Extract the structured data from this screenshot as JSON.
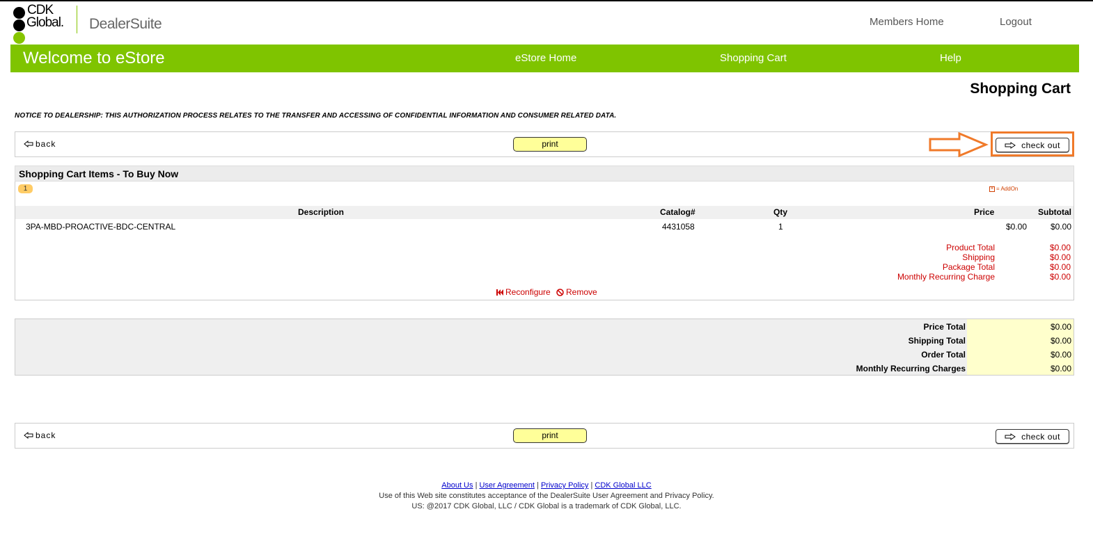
{
  "brand": {
    "cdk": "CDK",
    "global": "Global.",
    "product": "DealerSuite"
  },
  "top_nav": {
    "members_home": "Members Home",
    "logout": "Logout"
  },
  "store_bar": {
    "title": "Welcome to eStore",
    "estore_home": "eStore Home",
    "shopping_cart": "Shopping Cart",
    "help": "Help",
    "color": "#7fc400"
  },
  "page_title": "Shopping Cart",
  "notice": "NOTICE TO DEALERSHIP: THIS AUTHORIZATION PROCESS RELATES TO THE TRANSFER AND ACCESSING OF CONFIDENTIAL INFORMATION AND CONSUMER RELATED DATA.",
  "actions": {
    "back": "back",
    "print": "print",
    "checkout": "check out"
  },
  "cart": {
    "section_title": "Shopping Cart Items - To Buy Now",
    "badge": "1",
    "addon_legend": "= AddOn",
    "columns": {
      "description": "Description",
      "catalog": "Catalog#",
      "qty": "Qty",
      "price": "Price",
      "subtotal": "Subtotal"
    },
    "items": [
      {
        "description": "3PA-MBD-PROACTIVE-BDC-CENTRAL",
        "catalog": "4431058",
        "qty": "1",
        "price": "$0.00",
        "subtotal": "$0.00"
      }
    ],
    "totals": [
      {
        "label": "Product Total",
        "value": "$0.00"
      },
      {
        "label": "Shipping",
        "value": "$0.00"
      },
      {
        "label": "Package Total",
        "value": "$0.00"
      },
      {
        "label": "Monthly Recurring Charge",
        "value": "$0.00"
      }
    ],
    "reconfigure": "Reconfigure",
    "remove": "Remove"
  },
  "summary": [
    {
      "label": "Price Total",
      "value": "$0.00"
    },
    {
      "label": "Shipping Total",
      "value": "$0.00"
    },
    {
      "label": "Order Total",
      "value": "$0.00"
    },
    {
      "label": "Monthly Recurring Charges",
      "value": "$0.00"
    }
  ],
  "footer": {
    "links": [
      "About Us",
      "User Agreement",
      "Privacy Policy",
      "CDK Global LLC"
    ],
    "separator": "|",
    "line1": "Use of this Web site constitutes acceptance of the DealerSuite User Agreement and Privacy Policy.",
    "line2": "US: @2017 CDK Global, LLC / CDK Global is a trademark of CDK Global, LLC."
  },
  "icons": {
    "back": "arrow-left-outline-icon",
    "checkout": "arrow-right-outline-icon",
    "reconfigure": "skip-back-icon",
    "remove": "no-entry-icon",
    "annotation": "orange-arrow-icon"
  }
}
